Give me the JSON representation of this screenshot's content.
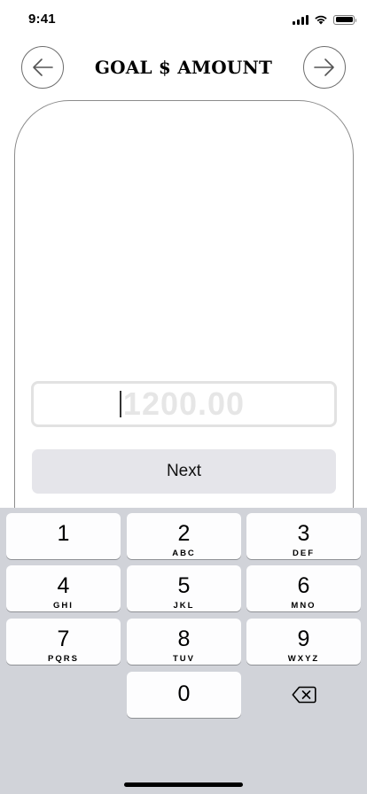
{
  "status_bar": {
    "time": "9:41",
    "battery_level": 1.0,
    "icons": [
      "cellular-signal-icon",
      "wifi-icon",
      "battery-icon"
    ]
  },
  "header": {
    "title": "GOAL $ AMOUNT",
    "back_icon": "arrow-left-icon",
    "forward_icon": "arrow-right-icon"
  },
  "amount_input": {
    "value": "",
    "placeholder": "1200.00"
  },
  "next_button": {
    "label": "Next"
  },
  "keypad": {
    "keys": [
      {
        "digit": "1",
        "letters": ""
      },
      {
        "digit": "2",
        "letters": "ABC"
      },
      {
        "digit": "3",
        "letters": "DEF"
      },
      {
        "digit": "4",
        "letters": "GHI"
      },
      {
        "digit": "5",
        "letters": "JKL"
      },
      {
        "digit": "6",
        "letters": "MNO"
      },
      {
        "digit": "7",
        "letters": "PQRS"
      },
      {
        "digit": "8",
        "letters": "TUV"
      },
      {
        "digit": "9",
        "letters": "WXYZ"
      },
      {
        "digit": "0",
        "letters": ""
      }
    ],
    "delete_icon": "backspace-icon"
  },
  "colors": {
    "keyboard_background": "#d1d3d9",
    "key_background": "#fdfdfe",
    "button_background": "#e5e5ea",
    "placeholder_text": "#e6e6e6"
  }
}
